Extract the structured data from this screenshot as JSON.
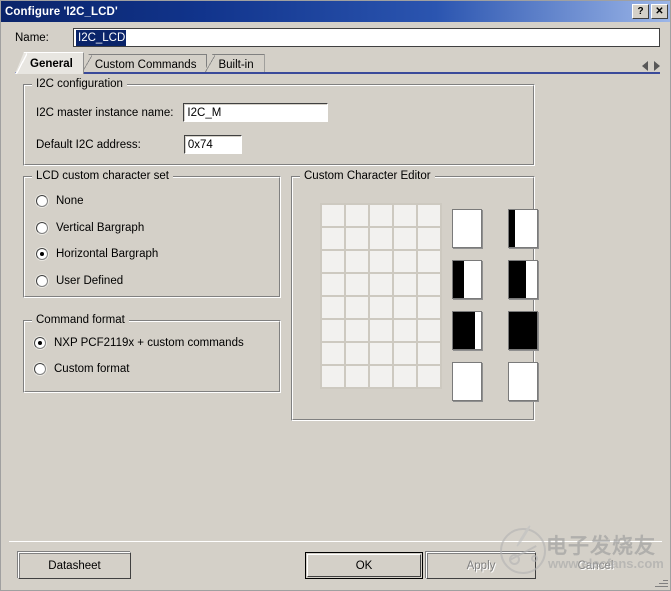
{
  "window": {
    "title": "Configure 'I2C_LCD'",
    "help_button": "?",
    "close_button": "✕"
  },
  "name_field": {
    "label": "Name:",
    "value": "I2C_LCD",
    "selected": true
  },
  "tabs": {
    "items": [
      {
        "label": "General",
        "active": true
      },
      {
        "label": "Custom Commands",
        "active": false
      },
      {
        "label": "Built-in",
        "active": false
      }
    ],
    "nav_prev_icon": "triangle-left-icon",
    "nav_next_icon": "triangle-right-icon"
  },
  "i2c_configuration": {
    "title": "I2C configuration",
    "master_instance_label": "I2C master instance name:",
    "master_instance_value": "I2C_M",
    "default_address_label": "Default I2C address:",
    "default_address_value": "0x74"
  },
  "lcd_custom_character_set": {
    "title": "LCD custom character set",
    "options": [
      {
        "label": "None",
        "checked": false
      },
      {
        "label": "Vertical Bargraph",
        "checked": false
      },
      {
        "label": "Horizontal Bargraph",
        "checked": true
      },
      {
        "label": "User Defined",
        "checked": false
      }
    ]
  },
  "command_format": {
    "title": "Command format",
    "options": [
      {
        "label": "NXP PCF2119x + custom commands",
        "checked": true
      },
      {
        "label": "Custom format",
        "checked": false
      }
    ]
  },
  "custom_character_editor": {
    "title": "Custom Character Editor",
    "grid": {
      "columns": 5,
      "rows": 8
    },
    "thumbnails": [
      {
        "index": 0,
        "fill_columns": 0
      },
      {
        "index": 1,
        "fill_columns": 1
      },
      {
        "index": 2,
        "fill_columns": 2
      },
      {
        "index": 3,
        "fill_columns": 3
      },
      {
        "index": 4,
        "fill_columns": 4
      },
      {
        "index": 5,
        "fill_columns": 5
      },
      {
        "index": 6,
        "fill_columns": 0
      },
      {
        "index": 7,
        "fill_columns": 0
      }
    ]
  },
  "footer": {
    "datasheet_label": "Datasheet",
    "ok_label": "OK",
    "apply_label": "Apply",
    "cancel_label": "Cancel",
    "apply_disabled": true
  },
  "watermark": {
    "chinese_text": "电子发烧友",
    "url_text": "www.elecfans.com"
  },
  "colors": {
    "titlebar_start": "#0a246a",
    "titlebar_end": "#9cb6e8",
    "dialog_face": "#d4d0c8",
    "selection": "#0a246a",
    "tab_underline": "#3a4a9a",
    "field_white": "#ffffff"
  }
}
